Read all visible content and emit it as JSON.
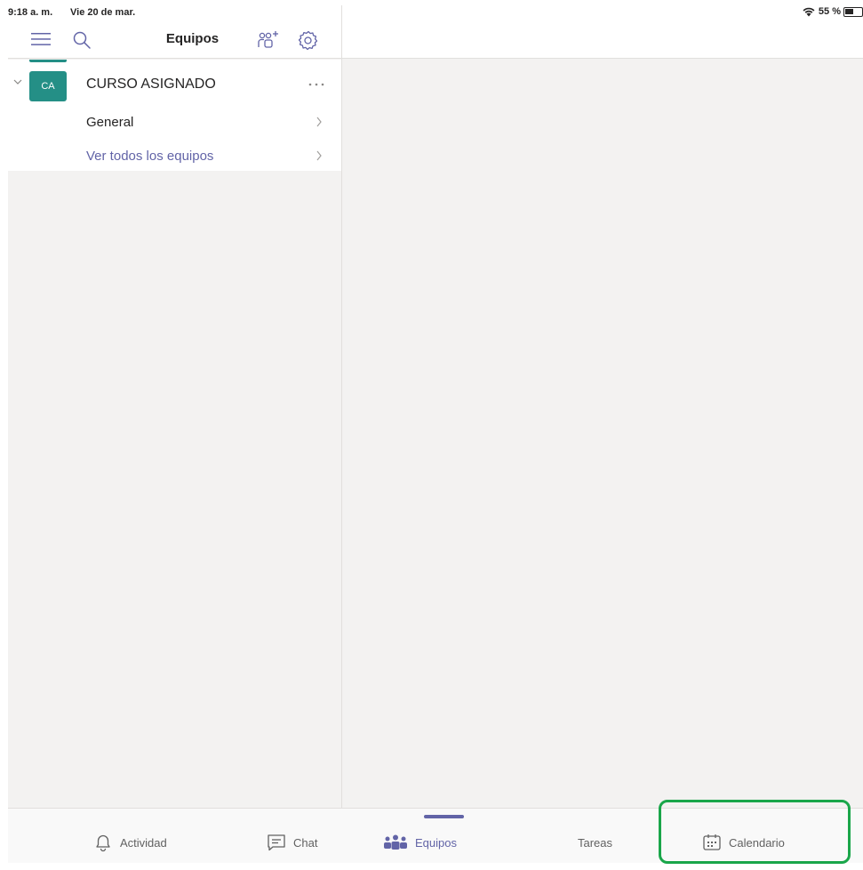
{
  "status_bar": {
    "time": "9:18 a. m.",
    "date": "Vie 20 de mar.",
    "battery": "55 %"
  },
  "header": {
    "title": "Equipos",
    "icons": [
      "hamburger-icon",
      "search-icon",
      "add-team-icon",
      "gear-icon"
    ]
  },
  "teams": [
    {
      "initials": "CA",
      "name": "CURSO ASIGNADO",
      "avatar_color": "#248f86",
      "channels": [
        {
          "label": "General"
        }
      ]
    }
  ],
  "see_all_teams": "Ver todos los equipos",
  "tab_bar": {
    "tabs": [
      {
        "label": "Actividad",
        "icon": "bell-icon"
      },
      {
        "label": "Chat",
        "icon": "chat-icon"
      },
      {
        "label": "Equipos",
        "icon": "teams-icon",
        "selected": true
      },
      {
        "label": "Tareas"
      },
      {
        "label": "Calendario",
        "icon": "calendar-icon"
      }
    ]
  },
  "colors": {
    "accent": "#6264a7",
    "highlight": "#1aa64a",
    "background": "#f3f2f1"
  }
}
